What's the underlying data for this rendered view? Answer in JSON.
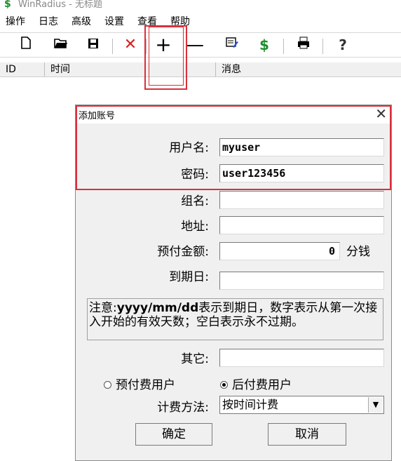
{
  "window": {
    "title": "WinRadius - 无标题"
  },
  "menu": {
    "items": [
      "操作",
      "日志",
      "高级",
      "设置",
      "查看",
      "帮助"
    ]
  },
  "list": {
    "columns": [
      "ID",
      "时间",
      "消息"
    ]
  },
  "dialog": {
    "title": "添加账号",
    "username_label": "用户名:",
    "username_value": "myuser",
    "password_label": "密码:",
    "password_value": "user123456",
    "group_label": "组名:",
    "group_value": "",
    "address_label": "地址:",
    "address_value": "",
    "prepaid_label": "预付金额:",
    "prepaid_value": "0",
    "prepaid_unit": "分钱",
    "expiry_label": "到期日:",
    "expiry_value": "",
    "note_prefix": "注意:",
    "note_format": "yyyy/mm/dd",
    "note_rest": "表示到期日，数字表示从第一次接入开始的有效天数；空白表示永不过期。",
    "other_label": "其它:",
    "other_value": "",
    "radio_prepaid": "预付费用户",
    "radio_postpaid": "后付费用户",
    "selected_radio": "postpaid",
    "billing_label": "计费方法:",
    "billing_value": "按时间计费",
    "ok_label": "确定",
    "cancel_label": "取消"
  },
  "colors": {
    "highlight": "#d9303b",
    "dollar": "#1a8f2a",
    "delete": "#d81e1e"
  }
}
